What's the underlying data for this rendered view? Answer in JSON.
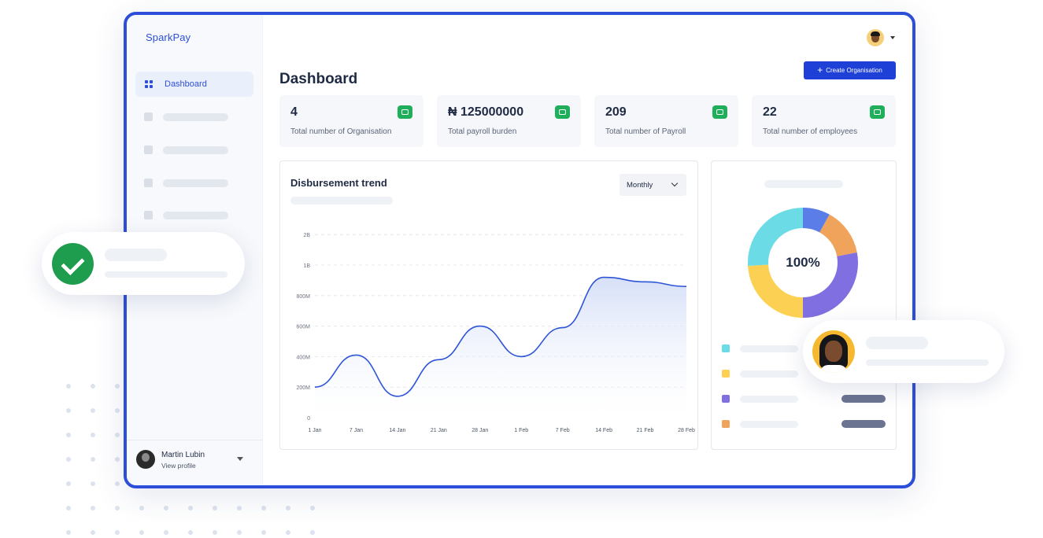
{
  "app": {
    "brand": "SparkPay",
    "sidebar": {
      "active_item": {
        "label": "Dashboard",
        "icon": "grid-icon"
      },
      "placeholder_items": 4
    },
    "profile": {
      "name": "Martin Lubin",
      "subtitle": "View profile"
    }
  },
  "header": {
    "title": "Dashboard",
    "create_button": "Create Organisation"
  },
  "stats": [
    {
      "value": "4",
      "label": "Total number of Organisation",
      "icon": "building-icon"
    },
    {
      "value": "₦ 125000000",
      "label": "Total payroll burden",
      "icon": "wallet-icon"
    },
    {
      "value": "209",
      "label": "Total number of Payroll",
      "icon": "document-icon"
    },
    {
      "value": "22",
      "label": "Total number of employees",
      "icon": "user-add-icon"
    }
  ],
  "trend": {
    "title": "Disbursement trend",
    "period_select": "Monthly"
  },
  "donut": {
    "center_label": "100%"
  },
  "colors": {
    "brand_blue": "#1e40d7",
    "frame_blue": "#2c4ed8",
    "success_green": "#1fae59",
    "line_blue": "#2d55d6"
  },
  "chart_data": [
    {
      "type": "area",
      "title": "Disbursement trend",
      "x": [
        "1 Jan",
        "7 Jan",
        "14 Jan",
        "21 Jan",
        "28 Jan",
        "1 Feb",
        "7 Feb",
        "14 Feb",
        "21 Feb",
        "28 Feb"
      ],
      "y_ticks": [
        "0",
        "200M",
        "400M",
        "600M",
        "800M",
        "1B",
        "2B"
      ],
      "values_in_tick_units": [
        1.0,
        2.05,
        0.7,
        1.9,
        3.0,
        2.0,
        2.95,
        4.6,
        4.45,
        4.3
      ],
      "ylim": [
        0,
        6
      ],
      "grid": true,
      "color": "#2d55d6"
    },
    {
      "type": "pie",
      "center_label": "100%",
      "slices": [
        {
          "value": 8,
          "color": "#5b7de8"
        },
        {
          "value": 14,
          "color": "#f0a35a"
        },
        {
          "value": 28,
          "color": "#7f6fe0"
        },
        {
          "value": 24,
          "color": "#fcd052"
        },
        {
          "value": 26,
          "color": "#6bdce6"
        }
      ],
      "legend_swatches": [
        "#6bdce6",
        "#fcd052",
        "#7f6fe0",
        "#f0a35a"
      ]
    }
  ]
}
